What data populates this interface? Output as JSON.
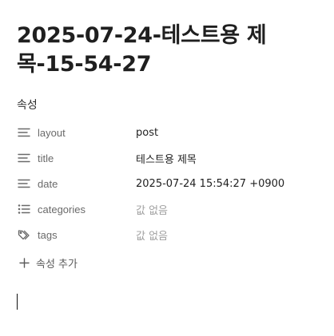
{
  "note": {
    "title": "2025-07-24-테스트용 제목-15-54-27"
  },
  "properties": {
    "header": "속성",
    "items": [
      {
        "key": "layout",
        "value": "post",
        "icon": "text-lines-icon",
        "empty": false
      },
      {
        "key": "title",
        "value": "테스트용 제목",
        "icon": "text-lines-icon",
        "empty": false
      },
      {
        "key": "date",
        "value": "2025-07-24 15:54:27 +0900",
        "icon": "text-lines-icon",
        "empty": false
      },
      {
        "key": "categories",
        "value": "값 없음",
        "icon": "list-icon",
        "empty": true
      },
      {
        "key": "tags",
        "value": "값 없음",
        "icon": "tags-icon",
        "empty": true
      }
    ],
    "add_label": "속성 추가"
  }
}
